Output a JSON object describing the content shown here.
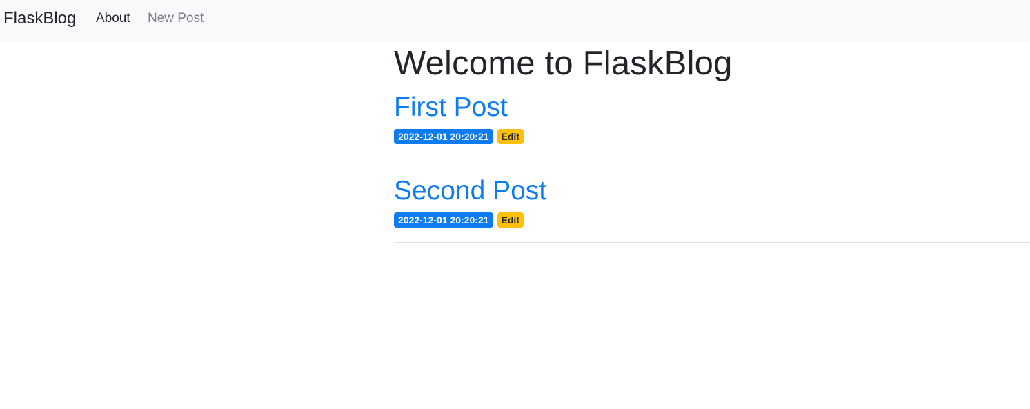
{
  "navbar": {
    "brand": "FlaskBlog",
    "links": [
      {
        "label": "About"
      },
      {
        "label": "New Post"
      }
    ]
  },
  "main": {
    "title": "Welcome to FlaskBlog",
    "posts": [
      {
        "title": "First Post",
        "created": "2022-12-01 20:20:21",
        "edit_label": "Edit"
      },
      {
        "title": "Second Post",
        "created": "2022-12-01 20:20:21",
        "edit_label": "Edit"
      }
    ]
  },
  "colors": {
    "navbar_bg": "#f8f9fa",
    "link_blue": "#0d7cf2",
    "badge_warning": "#ffc107",
    "text_dark": "#212529",
    "muted": "#7b7f83"
  }
}
